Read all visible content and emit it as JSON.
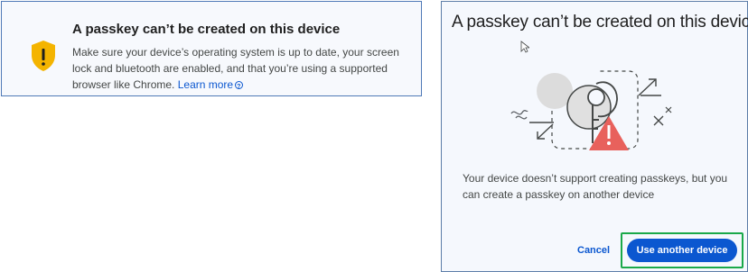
{
  "left_notice": {
    "title": "A passkey can’t be created on this device",
    "body": "Make sure your device’s operating system is up to date, your screen lock and bluetooth are enabled, and that you’re using a supported browser like Chrome.",
    "learn_more": "Learn more",
    "icon": "shield-warning-icon",
    "accent": "#f4b400"
  },
  "dialog": {
    "title": "A passkey can’t be created on this device",
    "description": "Your device doesn’t support creating passkeys, but you can create a passkey on another device",
    "cancel_label": "Cancel",
    "primary_label": "Use another device",
    "highlight_color": "#1aa94a",
    "button_color": "#0b57d0",
    "warning_color": "#e8615c",
    "illustration": "passkey-unavailable-illustration"
  }
}
